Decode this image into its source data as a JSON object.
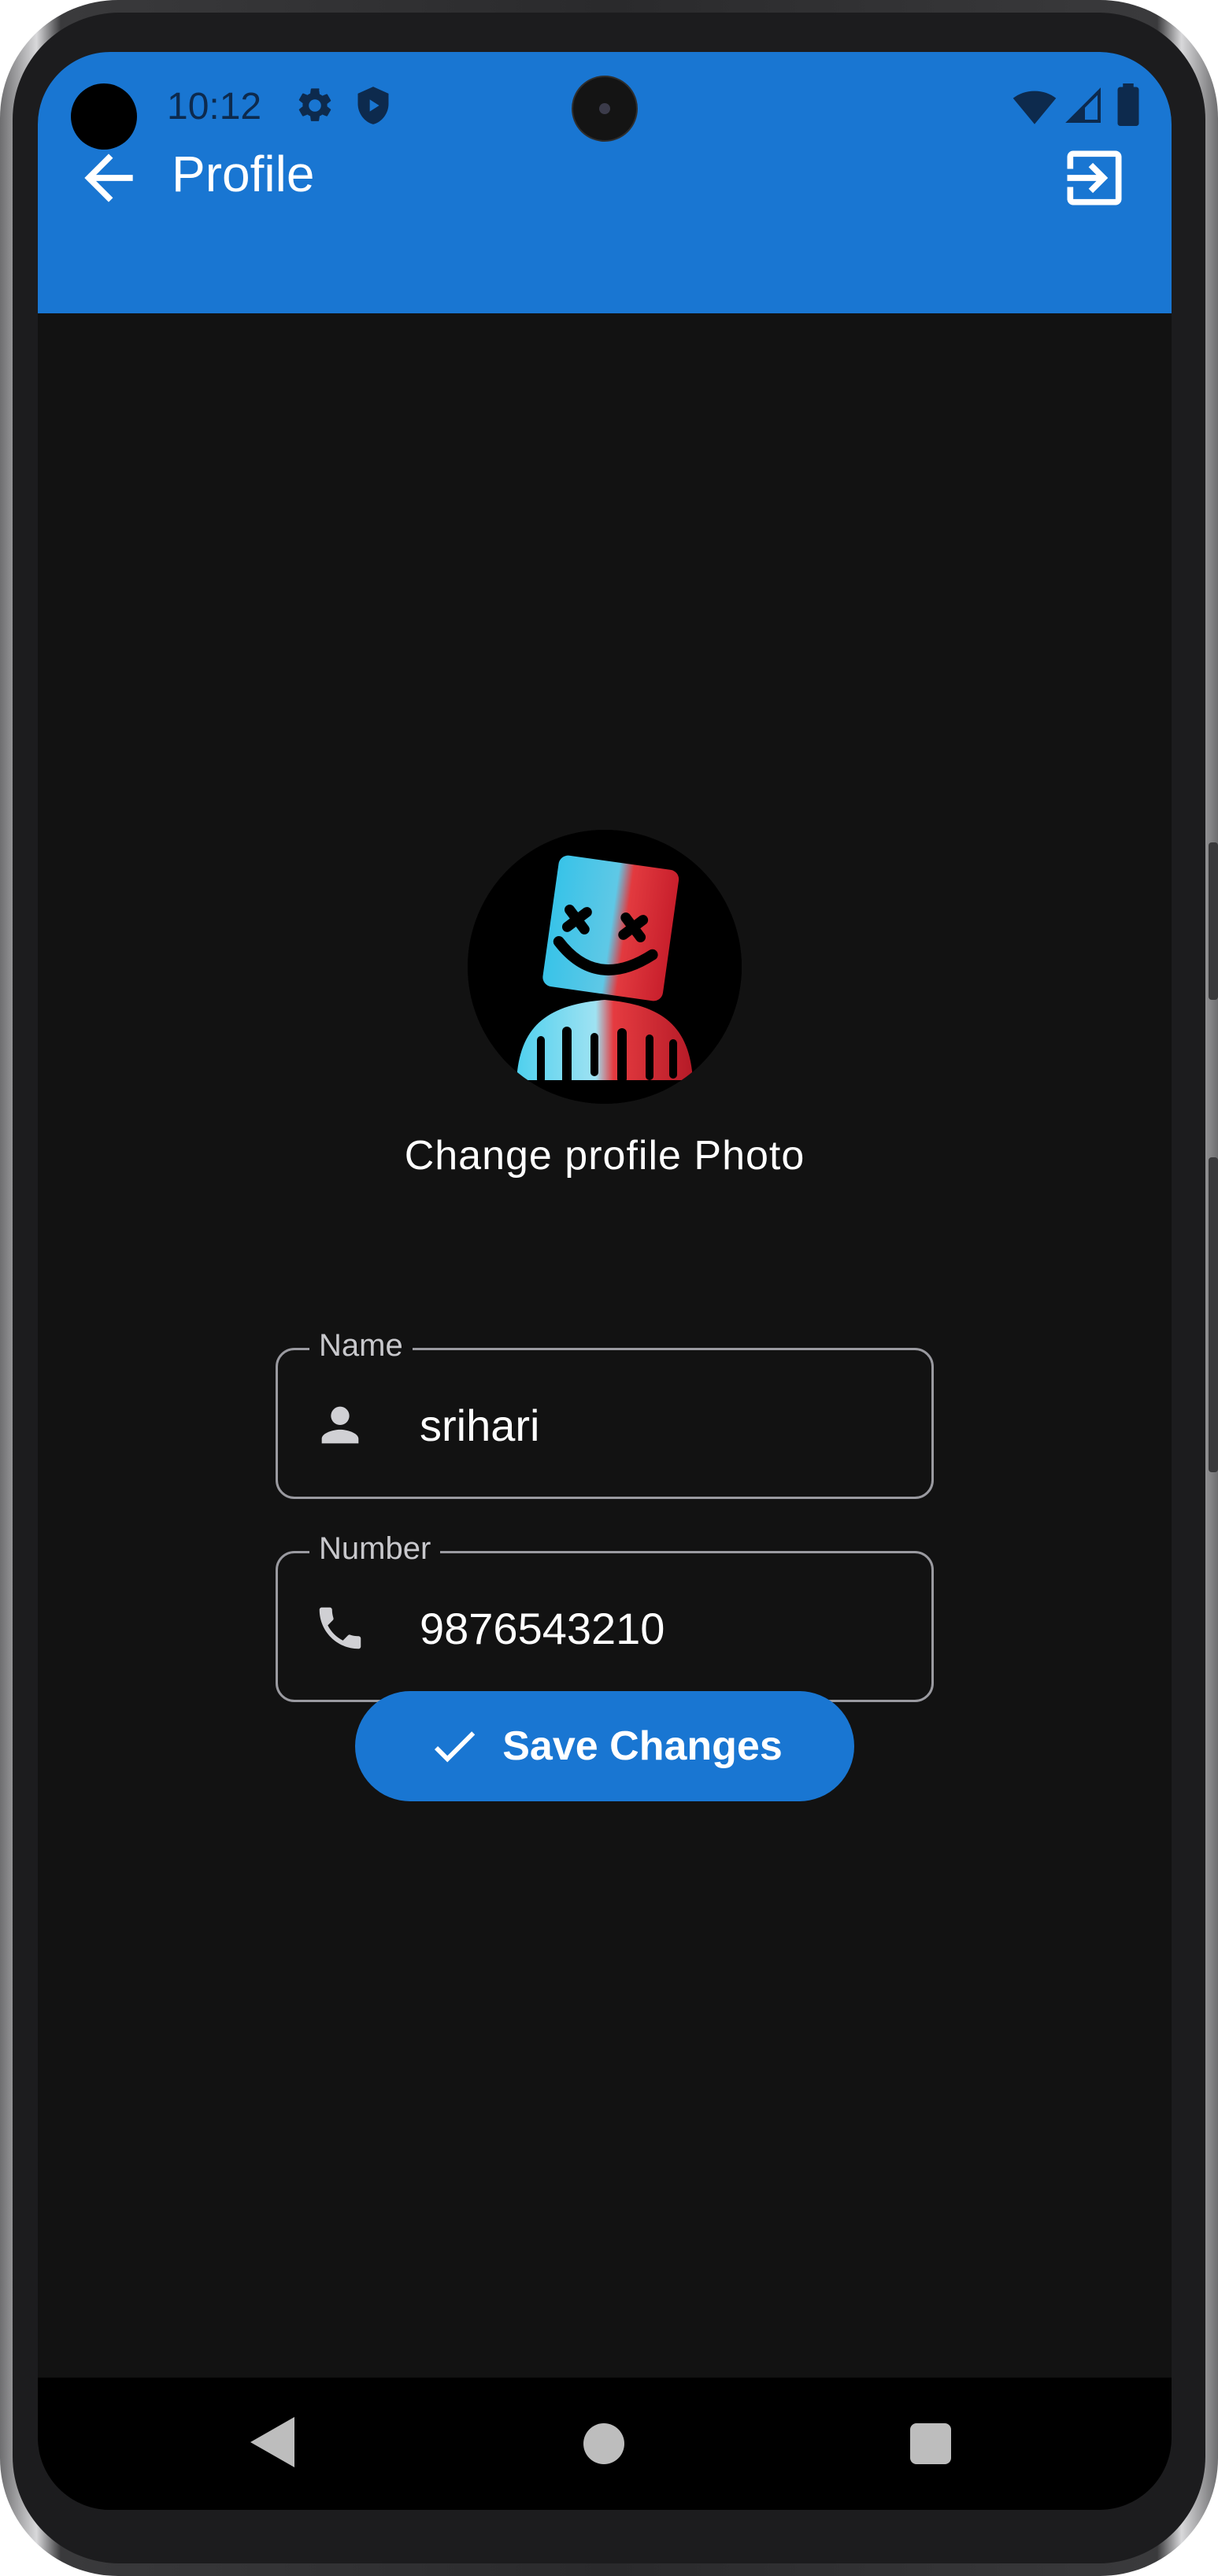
{
  "status_bar": {
    "time": "10:12",
    "icons": [
      "gear-icon",
      "shield-icon",
      "wifi-icon",
      "signal-icon",
      "battery-icon"
    ]
  },
  "app_bar": {
    "title": "Profile",
    "back_icon": "arrow-back-icon",
    "action_icon": "logout-icon"
  },
  "profile": {
    "avatar_alt": "profile photo",
    "change_photo_label": "Change profile Photo"
  },
  "form": {
    "name": {
      "label": "Name",
      "value": "srihari",
      "icon": "person-icon"
    },
    "number": {
      "label": "Number",
      "value": "9876543210",
      "icon": "phone-icon"
    }
  },
  "save_button": {
    "label": "Save Changes",
    "icon": "check-icon"
  },
  "nav_bar": {
    "items": [
      "back",
      "home",
      "recents"
    ]
  },
  "colors": {
    "primary": "#1976d2",
    "background": "#121212",
    "text": "#ffffff",
    "status_text": "#0d2a4d",
    "outline": "#9a9aa0"
  }
}
